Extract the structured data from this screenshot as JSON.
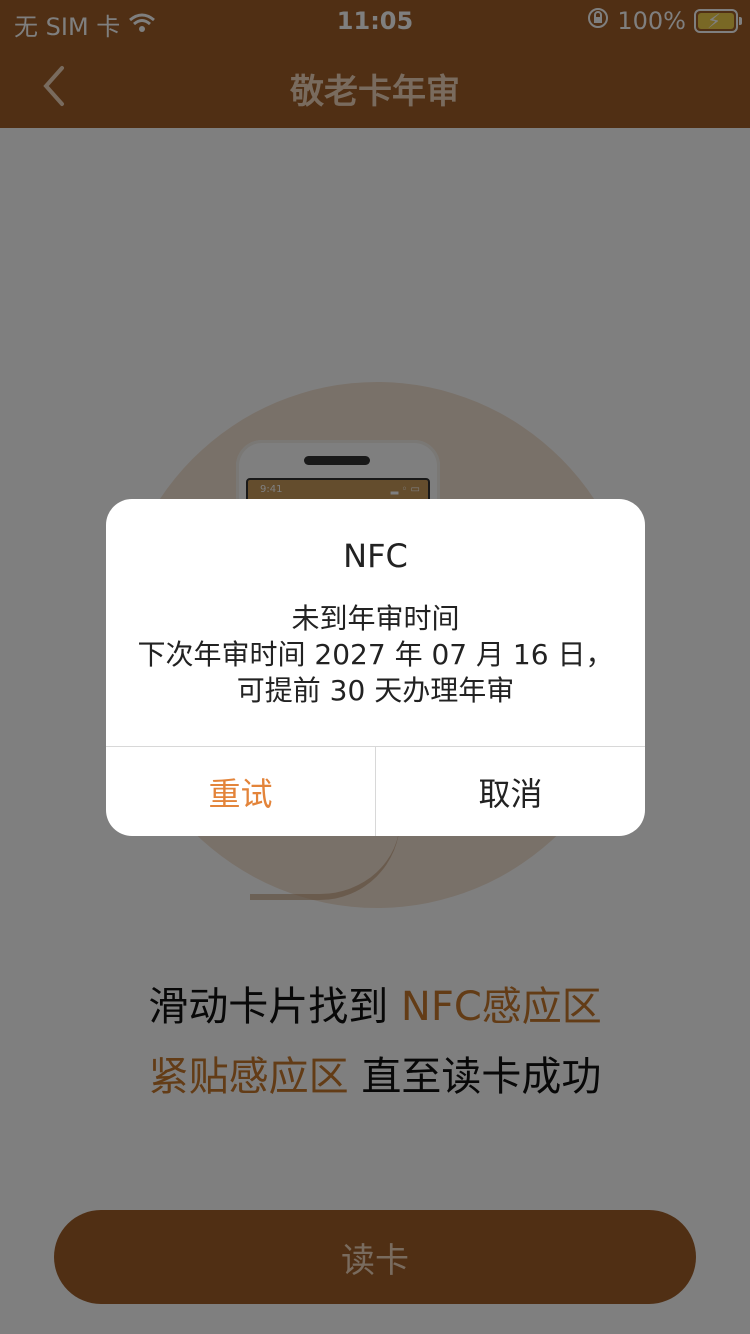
{
  "status_bar": {
    "carrier": "无 SIM 卡",
    "time": "11:05",
    "battery": "100%",
    "wifi_icon": "wifi-icon",
    "orientation_lock_icon": "orientation-lock-icon"
  },
  "nav": {
    "title": "敬老卡年审",
    "back_icon": "chevron-left-icon"
  },
  "illustration": {
    "phone_time": "9:41"
  },
  "instructions": {
    "line1_prefix": "滑动卡片找到 ",
    "line1_highlight": "NFC感应区",
    "line2_highlight": "紧贴感应区",
    "line2_suffix": " 直至读卡成功"
  },
  "read_button": {
    "label": "读卡"
  },
  "alert": {
    "title": "NFC",
    "line1": "未到年审时间",
    "line2": "下次年审时间 2027 年 07 月 16 日，",
    "line3": "可提前 30 天办理年审",
    "retry_label": "重试",
    "cancel_label": "取消"
  },
  "colors": {
    "brand_brown": "#a05f28",
    "highlight_orange": "#c7782c",
    "retry_orange": "#e3843a"
  }
}
